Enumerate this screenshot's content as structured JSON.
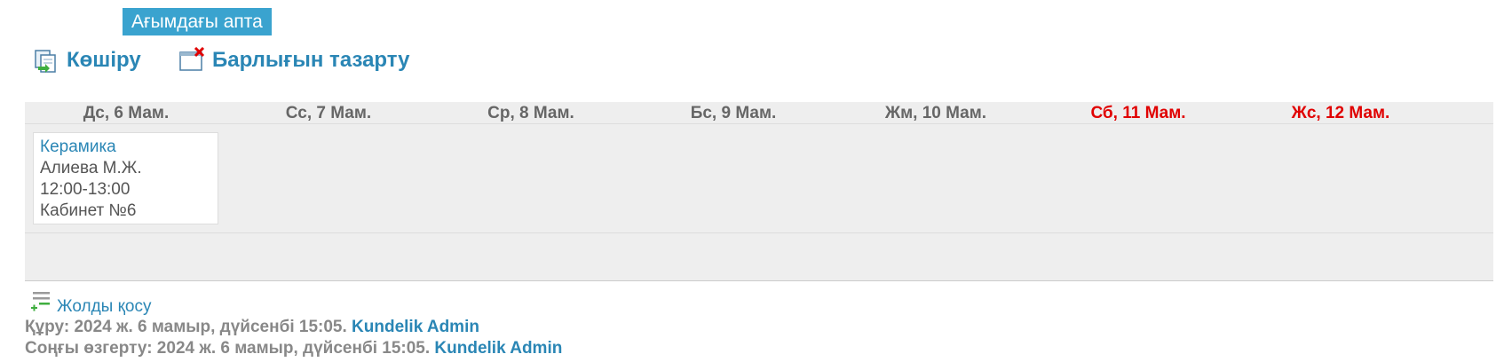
{
  "week_badge": "Ағымдағы апта",
  "actions": {
    "copy_label": "Көшіру",
    "clear_label": "Барлығын тазарту"
  },
  "days": [
    {
      "label": "Дс, 6 Мам.",
      "weekend": false
    },
    {
      "label": "Сс, 7 Мам.",
      "weekend": false
    },
    {
      "label": "Ср, 8 Мам.",
      "weekend": false
    },
    {
      "label": "Бс, 9 Мам.",
      "weekend": false
    },
    {
      "label": "Жм, 10 Мам.",
      "weekend": false
    },
    {
      "label": "Сб, 11 Мам.",
      "weekend": true
    },
    {
      "label": "Жс, 12 Мам.",
      "weekend": true
    }
  ],
  "lesson": {
    "subject": "Керамика",
    "teacher": "Алиева М.Ж.",
    "time": "12:00-13:00",
    "room": "Кабинет №6"
  },
  "add_row_label": "Жолды қосу",
  "meta": {
    "created_label": "Құру: 2024 ж. 6 мамыр, дүйсенбі 15:05.",
    "created_by": "Kundelik Admin",
    "modified_label": "Соңғы өзгерту: 2024 ж. 6 мамыр, дүйсенбі 15:05.",
    "modified_by": "Kundelik Admin"
  },
  "colors": {
    "accent": "#3aa3cf",
    "link": "#2a86b5",
    "weekend": "#e00000",
    "grid_bg": "#eeeeee"
  },
  "icons": {
    "copy": "copy-icon",
    "clear": "clear-all-icon",
    "add_row": "add-row-icon"
  }
}
